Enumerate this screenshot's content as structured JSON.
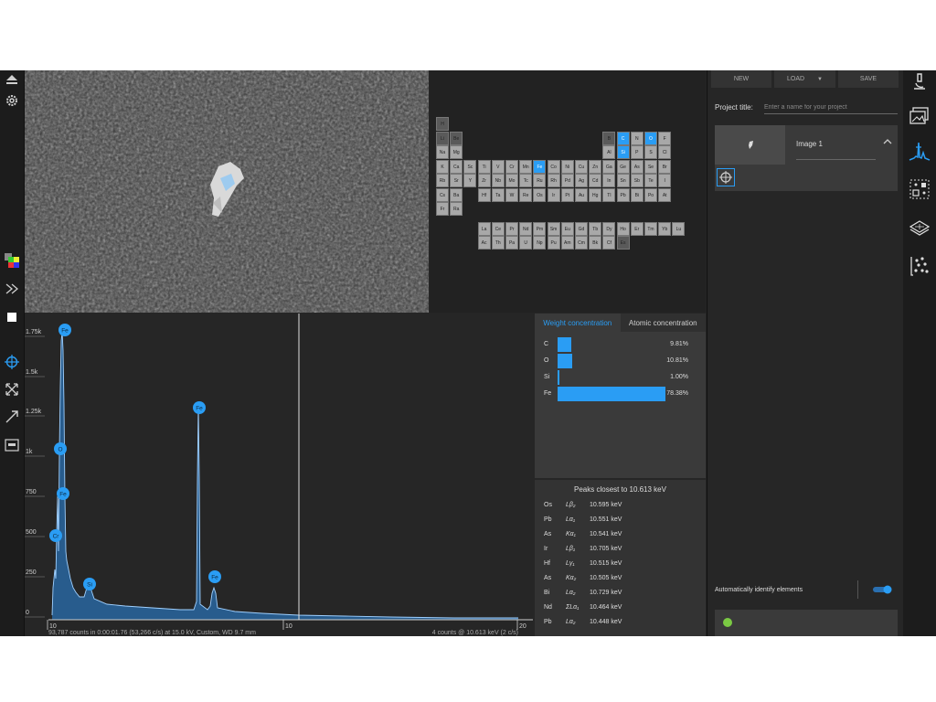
{
  "periodic_table": {
    "elements": [
      {
        "sym": "H",
        "row": 0,
        "col": 0,
        "state": "dim"
      },
      {
        "sym": "Li",
        "row": 1,
        "col": 0,
        "state": "dim"
      },
      {
        "sym": "Be",
        "row": 1,
        "col": 1,
        "state": "dim"
      },
      {
        "sym": "B",
        "row": 1,
        "col": 12,
        "state": "dim"
      },
      {
        "sym": "C",
        "row": 1,
        "col": 13,
        "state": "sel"
      },
      {
        "sym": "N",
        "row": 1,
        "col": 14,
        "state": "normal"
      },
      {
        "sym": "O",
        "row": 1,
        "col": 15,
        "state": "sel"
      },
      {
        "sym": "F",
        "row": 1,
        "col": 16,
        "state": "normal"
      },
      {
        "sym": "Na",
        "row": 2,
        "col": 0,
        "state": "normal"
      },
      {
        "sym": "Mg",
        "row": 2,
        "col": 1,
        "state": "normal"
      },
      {
        "sym": "Al",
        "row": 2,
        "col": 12,
        "state": "normal"
      },
      {
        "sym": "Si",
        "row": 2,
        "col": 13,
        "state": "sel"
      },
      {
        "sym": "P",
        "row": 2,
        "col": 14,
        "state": "normal"
      },
      {
        "sym": "S",
        "row": 2,
        "col": 15,
        "state": "normal"
      },
      {
        "sym": "Cl",
        "row": 2,
        "col": 16,
        "state": "normal"
      },
      {
        "sym": "K",
        "row": 3,
        "col": 0,
        "state": "normal"
      },
      {
        "sym": "Ca",
        "row": 3,
        "col": 1,
        "state": "normal"
      },
      {
        "sym": "Sc",
        "row": 3,
        "col": 2,
        "state": "normal"
      },
      {
        "sym": "Ti",
        "row": 3,
        "col": 3,
        "state": "normal"
      },
      {
        "sym": "V",
        "row": 3,
        "col": 4,
        "state": "normal"
      },
      {
        "sym": "Cr",
        "row": 3,
        "col": 5,
        "state": "normal"
      },
      {
        "sym": "Mn",
        "row": 3,
        "col": 6,
        "state": "normal"
      },
      {
        "sym": "Fe",
        "row": 3,
        "col": 7,
        "state": "sel"
      },
      {
        "sym": "Co",
        "row": 3,
        "col": 8,
        "state": "normal"
      },
      {
        "sym": "Ni",
        "row": 3,
        "col": 9,
        "state": "normal"
      },
      {
        "sym": "Cu",
        "row": 3,
        "col": 10,
        "state": "normal"
      },
      {
        "sym": "Zn",
        "row": 3,
        "col": 11,
        "state": "normal"
      },
      {
        "sym": "Ga",
        "row": 3,
        "col": 12,
        "state": "normal"
      },
      {
        "sym": "Ge",
        "row": 3,
        "col": 13,
        "state": "normal"
      },
      {
        "sym": "As",
        "row": 3,
        "col": 14,
        "state": "normal"
      },
      {
        "sym": "Se",
        "row": 3,
        "col": 15,
        "state": "normal"
      },
      {
        "sym": "Br",
        "row": 3,
        "col": 16,
        "state": "normal"
      },
      {
        "sym": "Rb",
        "row": 4,
        "col": 0,
        "state": "normal"
      },
      {
        "sym": "Sr",
        "row": 4,
        "col": 1,
        "state": "normal"
      },
      {
        "sym": "Y",
        "row": 4,
        "col": 2,
        "state": "normal"
      },
      {
        "sym": "Zr",
        "row": 4,
        "col": 3,
        "state": "normal"
      },
      {
        "sym": "Nb",
        "row": 4,
        "col": 4,
        "state": "normal"
      },
      {
        "sym": "Mo",
        "row": 4,
        "col": 5,
        "state": "normal"
      },
      {
        "sym": "Tc",
        "row": 4,
        "col": 6,
        "state": "normal"
      },
      {
        "sym": "Ru",
        "row": 4,
        "col": 7,
        "state": "normal"
      },
      {
        "sym": "Rh",
        "row": 4,
        "col": 8,
        "state": "normal"
      },
      {
        "sym": "Pd",
        "row": 4,
        "col": 9,
        "state": "normal"
      },
      {
        "sym": "Ag",
        "row": 4,
        "col": 10,
        "state": "normal"
      },
      {
        "sym": "Cd",
        "row": 4,
        "col": 11,
        "state": "normal"
      },
      {
        "sym": "In",
        "row": 4,
        "col": 12,
        "state": "normal"
      },
      {
        "sym": "Sn",
        "row": 4,
        "col": 13,
        "state": "normal"
      },
      {
        "sym": "Sb",
        "row": 4,
        "col": 14,
        "state": "normal"
      },
      {
        "sym": "Te",
        "row": 4,
        "col": 15,
        "state": "normal"
      },
      {
        "sym": "I",
        "row": 4,
        "col": 16,
        "state": "normal"
      },
      {
        "sym": "Cs",
        "row": 5,
        "col": 0,
        "state": "normal"
      },
      {
        "sym": "Ba",
        "row": 5,
        "col": 1,
        "state": "normal"
      },
      {
        "sym": "Hf",
        "row": 5,
        "col": 3,
        "state": "normal"
      },
      {
        "sym": "Ta",
        "row": 5,
        "col": 4,
        "state": "normal"
      },
      {
        "sym": "W",
        "row": 5,
        "col": 5,
        "state": "normal"
      },
      {
        "sym": "Re",
        "row": 5,
        "col": 6,
        "state": "normal"
      },
      {
        "sym": "Os",
        "row": 5,
        "col": 7,
        "state": "normal"
      },
      {
        "sym": "Ir",
        "row": 5,
        "col": 8,
        "state": "normal"
      },
      {
        "sym": "Pt",
        "row": 5,
        "col": 9,
        "state": "normal"
      },
      {
        "sym": "Au",
        "row": 5,
        "col": 10,
        "state": "normal"
      },
      {
        "sym": "Hg",
        "row": 5,
        "col": 11,
        "state": "normal"
      },
      {
        "sym": "Tl",
        "row": 5,
        "col": 12,
        "state": "normal"
      },
      {
        "sym": "Pb",
        "row": 5,
        "col": 13,
        "state": "normal"
      },
      {
        "sym": "Bi",
        "row": 5,
        "col": 14,
        "state": "normal"
      },
      {
        "sym": "Po",
        "row": 5,
        "col": 15,
        "state": "normal"
      },
      {
        "sym": "At",
        "row": 5,
        "col": 16,
        "state": "normal"
      },
      {
        "sym": "Fr",
        "row": 6,
        "col": 0,
        "state": "normal"
      },
      {
        "sym": "Ra",
        "row": 6,
        "col": 1,
        "state": "normal"
      },
      {
        "sym": "La",
        "row": 8,
        "col": 3,
        "state": "normal"
      },
      {
        "sym": "Ce",
        "row": 8,
        "col": 4,
        "state": "normal"
      },
      {
        "sym": "Pr",
        "row": 8,
        "col": 5,
        "state": "normal"
      },
      {
        "sym": "Nd",
        "row": 8,
        "col": 6,
        "state": "normal"
      },
      {
        "sym": "Pm",
        "row": 8,
        "col": 7,
        "state": "normal"
      },
      {
        "sym": "Sm",
        "row": 8,
        "col": 8,
        "state": "normal"
      },
      {
        "sym": "Eu",
        "row": 8,
        "col": 9,
        "state": "normal"
      },
      {
        "sym": "Gd",
        "row": 8,
        "col": 10,
        "state": "normal"
      },
      {
        "sym": "Tb",
        "row": 8,
        "col": 11,
        "state": "normal"
      },
      {
        "sym": "Dy",
        "row": 8,
        "col": 12,
        "state": "normal"
      },
      {
        "sym": "Ho",
        "row": 8,
        "col": 13,
        "state": "normal"
      },
      {
        "sym": "Er",
        "row": 8,
        "col": 14,
        "state": "normal"
      },
      {
        "sym": "Tm",
        "row": 8,
        "col": 15,
        "state": "normal"
      },
      {
        "sym": "Yb",
        "row": 8,
        "col": 16,
        "state": "normal"
      },
      {
        "sym": "Lu",
        "row": 8,
        "col": 17,
        "state": "normal"
      },
      {
        "sym": "Ac",
        "row": 9,
        "col": 3,
        "state": "normal"
      },
      {
        "sym": "Th",
        "row": 9,
        "col": 4,
        "state": "normal"
      },
      {
        "sym": "Pa",
        "row": 9,
        "col": 5,
        "state": "normal"
      },
      {
        "sym": "U",
        "row": 9,
        "col": 6,
        "state": "normal"
      },
      {
        "sym": "Np",
        "row": 9,
        "col": 7,
        "state": "normal"
      },
      {
        "sym": "Pu",
        "row": 9,
        "col": 8,
        "state": "normal"
      },
      {
        "sym": "Am",
        "row": 9,
        "col": 9,
        "state": "normal"
      },
      {
        "sym": "Cm",
        "row": 9,
        "col": 10,
        "state": "normal"
      },
      {
        "sym": "Bk",
        "row": 9,
        "col": 11,
        "state": "normal"
      },
      {
        "sym": "Cf",
        "row": 9,
        "col": 12,
        "state": "normal"
      },
      {
        "sym": "Es",
        "row": 9,
        "col": 13,
        "state": "dim"
      }
    ]
  },
  "spectrum": {
    "y_ticks": [
      "1.75k",
      "1.5k",
      "1.25k",
      "1k",
      "750",
      "500",
      "250",
      "0"
    ],
    "x_ticks": [
      "10",
      "10",
      "20"
    ],
    "peak_labels": [
      "Fe",
      "O",
      "Fe",
      "Cr",
      "Si",
      "Fe",
      "Fe"
    ],
    "footer_left": "93,787 counts in 0:00:01.76 (53,266 c/s) at 15.0 kV, Custom, WD 9.7 mm",
    "footer_right": "4 counts @ 10.613 keV (2 c/s)"
  },
  "concentration": {
    "tabs": [
      "Weight concentration",
      "Atomic concentration"
    ],
    "rows": [
      {
        "element": "C",
        "value_text": "9.81%",
        "percent": 9.81
      },
      {
        "element": "O",
        "value_text": "10.81%",
        "percent": 10.81
      },
      {
        "element": "Si",
        "value_text": "1.00%",
        "percent": 1.0
      },
      {
        "element": "Fe",
        "value_text": "78.38%",
        "percent": 78.38
      }
    ]
  },
  "peaks": {
    "title": "Peaks closest to 10.613 keV",
    "rows": [
      {
        "element": "Os",
        "line": "Lβ₂",
        "energy": "10.595 keV"
      },
      {
        "element": "Pb",
        "line": "Lα₁",
        "energy": "10.551 keV"
      },
      {
        "element": "As",
        "line": "Kα₁",
        "energy": "10.541 keV"
      },
      {
        "element": "Ir",
        "line": "Lβ₁",
        "energy": "10.705 keV"
      },
      {
        "element": "Hf",
        "line": "Lγ₁",
        "energy": "10.515 keV"
      },
      {
        "element": "As",
        "line": "Kα₂",
        "energy": "10.505 keV"
      },
      {
        "element": "Bi",
        "line": "Lα₂",
        "energy": "10.729 keV"
      },
      {
        "element": "Nd",
        "line": "ΣLα₁",
        "energy": "10.464 keV"
      },
      {
        "element": "Pb",
        "line": "Lα₂",
        "energy": "10.448 keV"
      }
    ]
  },
  "project": {
    "buttons": [
      "NEW",
      "LOAD",
      "SAVE"
    ],
    "title_label": "Project title:",
    "title_placeholder": "Enter a name for your project",
    "image_name": "Image 1",
    "auto_identify_label": "Automatically identify elements",
    "auto_identify_on": true
  },
  "colors": {
    "accent": "#2a9df4",
    "panel": "#262626",
    "toolbar": "#1c1c1c"
  }
}
